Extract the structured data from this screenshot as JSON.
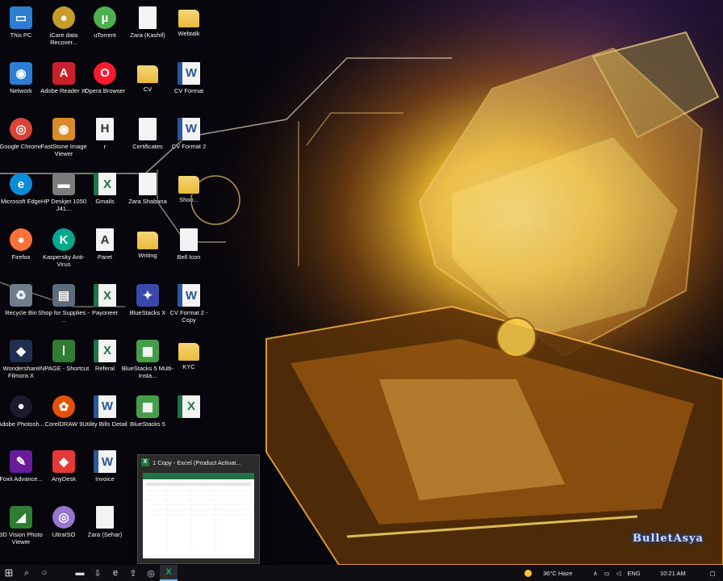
{
  "desktop": {
    "icons": [
      {
        "label": "This PC",
        "glyph": "pc-icon",
        "symbol": "▭",
        "bg": "#2d7dd2",
        "kind": "app"
      },
      {
        "label": "Network",
        "glyph": "network-icon",
        "symbol": "◉",
        "bg": "#2d7dd2",
        "kind": "app"
      },
      {
        "label": "Google Chrome",
        "glyph": "chrome-icon",
        "symbol": "◎",
        "bg": "#db4437",
        "kind": "round"
      },
      {
        "label": "Microsoft Edge",
        "glyph": "edge-icon",
        "symbol": "e",
        "bg": "#0c8bd6",
        "kind": "round"
      },
      {
        "label": "Firefox",
        "glyph": "firefox-icon",
        "symbol": "●",
        "bg": "#ff7139",
        "kind": "round"
      },
      {
        "label": "Recycle Bin",
        "glyph": "recycle-bin-icon",
        "symbol": "♻",
        "bg": "#6f7c8a",
        "kind": "app"
      },
      {
        "label": "Wondershare Filmora X",
        "glyph": "filmora-icon",
        "symbol": "◆",
        "bg": "#1f2f4f",
        "kind": "app"
      },
      {
        "label": "Adobe Photosh...",
        "glyph": "photoshop-icon",
        "symbol": "●",
        "bg": "#1b1b2e",
        "kind": "round"
      },
      {
        "label": "Foxit Advance...",
        "glyph": "foxit-icon",
        "symbol": "✎",
        "bg": "#6a1b9a",
        "kind": "app"
      },
      {
        "label": "3D Vision Photo Viewer",
        "glyph": "3d-vision-icon",
        "symbol": "◢",
        "bg": "#2e7d32",
        "kind": "app"
      },
      {
        "label": "iCare data Recover...",
        "glyph": "icare-icon",
        "symbol": "●",
        "bg": "#c69c2a",
        "kind": "round"
      },
      {
        "label": "Adobe Reader XI",
        "glyph": "adobe-reader-icon",
        "symbol": "A",
        "bg": "#c9202a",
        "kind": "app"
      },
      {
        "label": "FastStone Image Viewer",
        "glyph": "faststone-icon",
        "symbol": "◉",
        "bg": "#d98b2a",
        "kind": "app"
      },
      {
        "label": "HP Deskjet 1050 J41...",
        "glyph": "printer-icon",
        "symbol": "▬",
        "bg": "#7c7c7c",
        "kind": "app"
      },
      {
        "label": "Kaspersky Anti-Virus",
        "glyph": "kaspersky-icon",
        "symbol": "K",
        "bg": "#00a88e",
        "kind": "round"
      },
      {
        "label": "Shop for Supplies - ...",
        "glyph": "shop-supplies-icon",
        "symbol": "▤",
        "bg": "#5e6b78",
        "kind": "app"
      },
      {
        "label": "INPAGE - Shortcut",
        "glyph": "inpage-icon",
        "symbol": "ا",
        "bg": "#2e7d32",
        "kind": "app"
      },
      {
        "label": "CorelDRAW 9",
        "glyph": "coreldraw-icon",
        "symbol": "✿",
        "bg": "#e65100",
        "kind": "round"
      },
      {
        "label": "AnyDesk",
        "glyph": "anydesk-icon",
        "symbol": "◆",
        "bg": "#e53935",
        "kind": "app"
      },
      {
        "label": "UltraISO",
        "glyph": "ultraiso-icon",
        "symbol": "◎",
        "bg": "#9575cd",
        "kind": "round"
      },
      {
        "label": "uTorrent",
        "glyph": "utorrent-icon",
        "symbol": "µ",
        "bg": "#4caf50",
        "kind": "round"
      },
      {
        "label": "Opera Browser",
        "glyph": "opera-icon",
        "symbol": "O",
        "bg": "#ff1b2d",
        "kind": "round"
      },
      {
        "label": "r",
        "glyph": "document-icon",
        "symbol": "H",
        "bg": "#f3f3f3",
        "kind": "doc"
      },
      {
        "label": "Gmails",
        "glyph": "excel-file-icon",
        "symbol": "X",
        "bg": "#217346",
        "kind": "excel"
      },
      {
        "label": "Paret",
        "glyph": "pdf-file-icon",
        "symbol": "A",
        "bg": "#c9202a",
        "kind": "doc"
      },
      {
        "label": "Payoneer",
        "glyph": "excel-file-icon",
        "symbol": "X",
        "bg": "#217346",
        "kind": "excel"
      },
      {
        "label": "Referal",
        "glyph": "excel-file-icon",
        "symbol": "X",
        "bg": "#217346",
        "kind": "excel"
      },
      {
        "label": "Utility Bills Detail",
        "glyph": "word-file-icon",
        "symbol": "W",
        "bg": "#2b579a",
        "kind": "word"
      },
      {
        "label": "Invoice",
        "glyph": "word-file-icon",
        "symbol": "W",
        "bg": "#2b579a",
        "kind": "word"
      },
      {
        "label": "Zara (Sehar)",
        "glyph": "document-icon",
        "symbol": "",
        "bg": "#f3f3f3",
        "kind": "doc"
      },
      {
        "label": "Zara (Kashif)",
        "glyph": "document-icon",
        "symbol": "",
        "bg": "#f3f3f3",
        "kind": "doc"
      },
      {
        "label": "CV",
        "glyph": "folder-icon",
        "symbol": "",
        "bg": "#e8b83c",
        "kind": "folder"
      },
      {
        "label": "Certificates",
        "glyph": "certificate-file-icon",
        "symbol": "",
        "bg": "#f3f3f3",
        "kind": "doc"
      },
      {
        "label": "Zara Shabana",
        "glyph": "document-icon",
        "symbol": "",
        "bg": "#f3f3f3",
        "kind": "doc"
      },
      {
        "label": "Writing",
        "glyph": "folder-icon",
        "symbol": "",
        "bg": "#e8b83c",
        "kind": "folder"
      },
      {
        "label": "BlueStacks X",
        "glyph": "bluestacks-x-icon",
        "symbol": "✦",
        "bg": "#3949ab",
        "kind": "app"
      },
      {
        "label": "BlueStacks 5 Multi-Insta...",
        "glyph": "bluestacks-multi-icon",
        "symbol": "▦",
        "bg": "#43a047",
        "kind": "app"
      },
      {
        "label": "BlueStacks 5",
        "glyph": "bluestacks-icon",
        "symbol": "▦",
        "bg": "#43a047",
        "kind": "app"
      },
      {
        "label": "Webtalk",
        "glyph": "folder-icon",
        "symbol": "",
        "bg": "#e8b83c",
        "kind": "folder"
      },
      {
        "label": "CV Format",
        "glyph": "word-file-icon",
        "symbol": "W",
        "bg": "#2b579a",
        "kind": "word"
      },
      {
        "label": "CV Format 2",
        "glyph": "word-file-icon",
        "symbol": "W",
        "bg": "#2b579a",
        "kind": "word"
      },
      {
        "label": "Shoo...",
        "glyph": "folder-icon",
        "symbol": "",
        "bg": "#e8b83c",
        "kind": "folder"
      },
      {
        "label": "Bell Icon",
        "glyph": "bell-file-icon",
        "symbol": "",
        "bg": "#f3f3f3",
        "kind": "doc"
      },
      {
        "label": "CV Format 2 - Copy",
        "glyph": "word-file-icon",
        "symbol": "W",
        "bg": "#2b579a",
        "kind": "word"
      },
      {
        "label": "KYC",
        "glyph": "folder-icon",
        "symbol": "",
        "bg": "#e8b83c",
        "kind": "folder"
      },
      {
        "label": "",
        "glyph": "excel-file-icon",
        "symbol": "X",
        "bg": "#217346",
        "kind": "excel"
      }
    ]
  },
  "preview": {
    "title": "1 Copy - Excel (Product Activat...",
    "app_glyph": "X"
  },
  "taskbar": {
    "start_glyph": "⊞",
    "search_glyph": "⌕",
    "taskview_glyph": "○",
    "pinned": [
      {
        "name": "file-explorer-icon",
        "glyph": "▬",
        "active": false
      },
      {
        "name": "download-icon",
        "glyph": "⇩",
        "active": false
      },
      {
        "name": "edge-taskbar-icon",
        "glyph": "e",
        "active": false
      },
      {
        "name": "store-icon",
        "glyph": "⇪",
        "active": false
      },
      {
        "name": "chrome-taskbar-icon",
        "glyph": "◎",
        "active": false
      },
      {
        "name": "excel-taskbar-icon",
        "glyph": "X",
        "active": true
      }
    ],
    "weather": "36°C  Haze",
    "language": "ENG",
    "time": "10:21 AM"
  },
  "watermark": "BulletAsya",
  "colors": {
    "accent": "#76b9ed",
    "wallpaper_glow": "#f6c531",
    "taskbar": "#0f0f13"
  }
}
